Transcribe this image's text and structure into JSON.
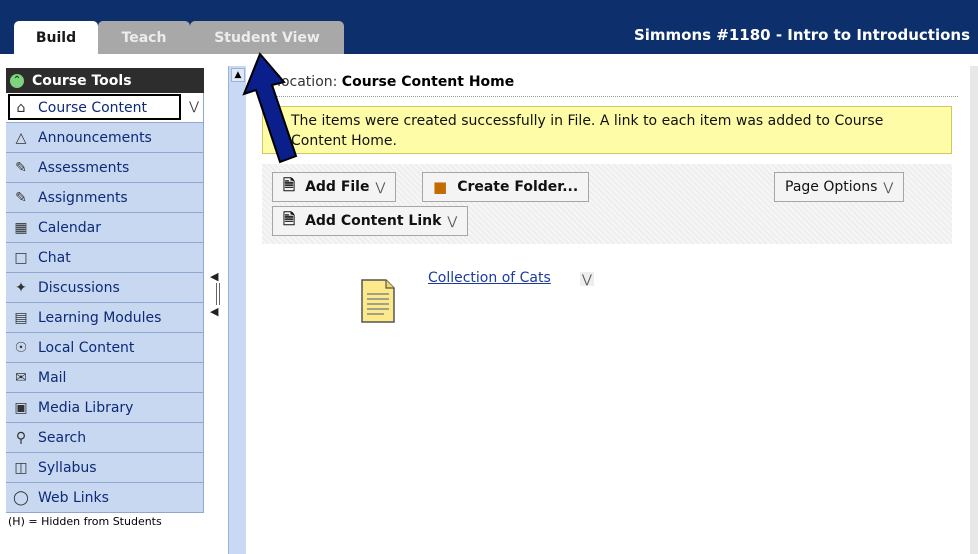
{
  "tabs": [
    {
      "label": "Build",
      "active": true
    },
    {
      "label": "Teach",
      "active": false
    },
    {
      "label": "Student View",
      "active": false
    }
  ],
  "course_title": "Simmons #1180 - Intro to Introductions",
  "nav": {
    "header": "Course Tools",
    "items": [
      {
        "label": "Course Content",
        "icon": "house-icon",
        "active": true
      },
      {
        "label": "Announcements",
        "icon": "megaphone-icon"
      },
      {
        "label": "Assessments",
        "icon": "assessment-icon"
      },
      {
        "label": "Assignments",
        "icon": "assignment-icon"
      },
      {
        "label": "Calendar",
        "icon": "calendar-icon"
      },
      {
        "label": "Chat",
        "icon": "chat-icon"
      },
      {
        "label": "Discussions",
        "icon": "pin-icon"
      },
      {
        "label": "Learning Modules",
        "icon": "module-icon"
      },
      {
        "label": "Local Content",
        "icon": "disc-icon"
      },
      {
        "label": "Mail",
        "icon": "mail-icon"
      },
      {
        "label": "Media Library",
        "icon": "media-icon"
      },
      {
        "label": "Search",
        "icon": "magnifier-icon"
      },
      {
        "label": "Syllabus",
        "icon": "syllabus-icon"
      },
      {
        "label": "Web Links",
        "icon": "globe-icon"
      }
    ],
    "footer": "(H) = Hidden from Students"
  },
  "location": {
    "prefix": "ur location: ",
    "value": "Course Content Home"
  },
  "message": "The items were created successfully in File. A link to each item was added to Course Content Home.",
  "actions": {
    "add_file": "Add File",
    "create_folder": "Create Folder...",
    "page_options": "Page Options",
    "add_content_link": "Add Content Link"
  },
  "content_item": {
    "label": "Collection of Cats",
    "icon": "document-icon"
  },
  "colors": {
    "topbar": "#0d2f6b",
    "nav_item": "#c8d8f0",
    "message_bg": "#fffca8",
    "annotation_arrow": "#0a1e8c"
  }
}
